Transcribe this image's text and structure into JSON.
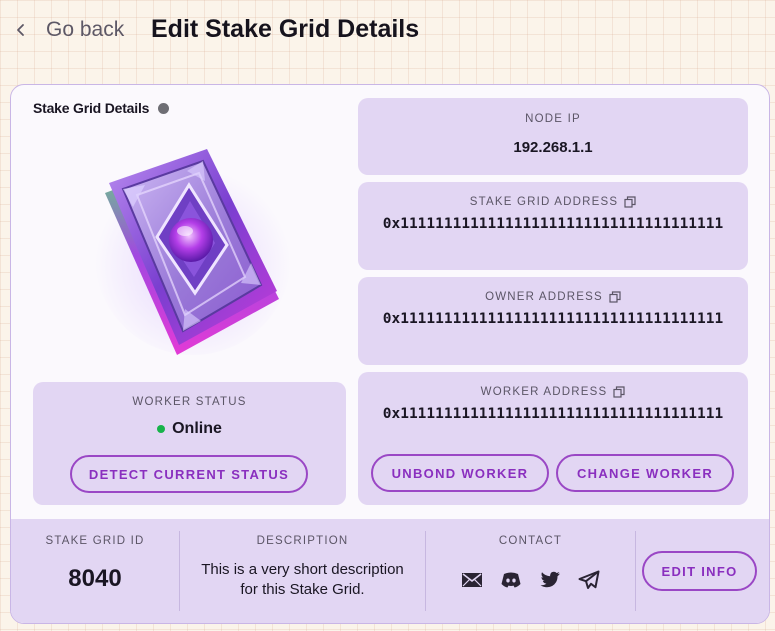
{
  "header": {
    "back_label": "Go back",
    "title": "Edit Stake Grid Details"
  },
  "stake_grid": {
    "title": "Stake Grid Details"
  },
  "worker_status": {
    "label": "WORKER STATUS",
    "value": "Online",
    "detect_button": "DETECT CURRENT STATUS"
  },
  "node_ip": {
    "label": "NODE IP",
    "value": "192.268.1.1"
  },
  "stake_grid_address": {
    "label": "STAKE GRID ADDRESS",
    "value": "0x1111111111111111111111111111111111111"
  },
  "owner_address": {
    "label": "OWNER ADDRESS",
    "value": "0x1111111111111111111111111111111111111"
  },
  "worker_address": {
    "label": "WORKER ADDRESS",
    "value": "0x1111111111111111111111111111111111111",
    "unbond_button": "UNBOND WORKER",
    "change_button": "CHANGE WORKER"
  },
  "footer": {
    "stake_grid_id_label": "STAKE GRID ID",
    "stake_grid_id_value": "8040",
    "description_label": "DESCRIPTION",
    "description_value": "This is a very short description for this Stake Grid.",
    "contact_label": "CONTACT",
    "contact_icons": [
      "mail-icon",
      "discord-icon",
      "twitter-icon",
      "telegram-icon"
    ],
    "edit_button": "EDIT INFO"
  },
  "colors": {
    "accent": "#8a2fbf",
    "panel": "#e2d6f3",
    "status_online": "#17b34a"
  }
}
